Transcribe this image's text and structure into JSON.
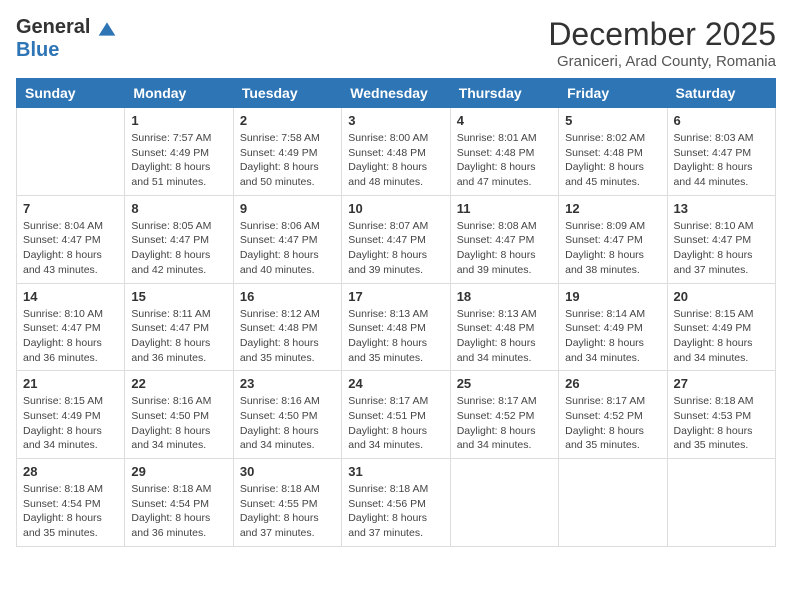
{
  "logo": {
    "general": "General",
    "blue": "Blue"
  },
  "header": {
    "month": "December 2025",
    "location": "Graniceri, Arad County, Romania"
  },
  "weekdays": [
    "Sunday",
    "Monday",
    "Tuesday",
    "Wednesday",
    "Thursday",
    "Friday",
    "Saturday"
  ],
  "weeks": [
    [
      {
        "day": "",
        "sunrise": "",
        "sunset": "",
        "daylight": ""
      },
      {
        "day": "1",
        "sunrise": "Sunrise: 7:57 AM",
        "sunset": "Sunset: 4:49 PM",
        "daylight": "Daylight: 8 hours and 51 minutes."
      },
      {
        "day": "2",
        "sunrise": "Sunrise: 7:58 AM",
        "sunset": "Sunset: 4:49 PM",
        "daylight": "Daylight: 8 hours and 50 minutes."
      },
      {
        "day": "3",
        "sunrise": "Sunrise: 8:00 AM",
        "sunset": "Sunset: 4:48 PM",
        "daylight": "Daylight: 8 hours and 48 minutes."
      },
      {
        "day": "4",
        "sunrise": "Sunrise: 8:01 AM",
        "sunset": "Sunset: 4:48 PM",
        "daylight": "Daylight: 8 hours and 47 minutes."
      },
      {
        "day": "5",
        "sunrise": "Sunrise: 8:02 AM",
        "sunset": "Sunset: 4:48 PM",
        "daylight": "Daylight: 8 hours and 45 minutes."
      },
      {
        "day": "6",
        "sunrise": "Sunrise: 8:03 AM",
        "sunset": "Sunset: 4:47 PM",
        "daylight": "Daylight: 8 hours and 44 minutes."
      }
    ],
    [
      {
        "day": "7",
        "sunrise": "Sunrise: 8:04 AM",
        "sunset": "Sunset: 4:47 PM",
        "daylight": "Daylight: 8 hours and 43 minutes."
      },
      {
        "day": "8",
        "sunrise": "Sunrise: 8:05 AM",
        "sunset": "Sunset: 4:47 PM",
        "daylight": "Daylight: 8 hours and 42 minutes."
      },
      {
        "day": "9",
        "sunrise": "Sunrise: 8:06 AM",
        "sunset": "Sunset: 4:47 PM",
        "daylight": "Daylight: 8 hours and 40 minutes."
      },
      {
        "day": "10",
        "sunrise": "Sunrise: 8:07 AM",
        "sunset": "Sunset: 4:47 PM",
        "daylight": "Daylight: 8 hours and 39 minutes."
      },
      {
        "day": "11",
        "sunrise": "Sunrise: 8:08 AM",
        "sunset": "Sunset: 4:47 PM",
        "daylight": "Daylight: 8 hours and 39 minutes."
      },
      {
        "day": "12",
        "sunrise": "Sunrise: 8:09 AM",
        "sunset": "Sunset: 4:47 PM",
        "daylight": "Daylight: 8 hours and 38 minutes."
      },
      {
        "day": "13",
        "sunrise": "Sunrise: 8:10 AM",
        "sunset": "Sunset: 4:47 PM",
        "daylight": "Daylight: 8 hours and 37 minutes."
      }
    ],
    [
      {
        "day": "14",
        "sunrise": "Sunrise: 8:10 AM",
        "sunset": "Sunset: 4:47 PM",
        "daylight": "Daylight: 8 hours and 36 minutes."
      },
      {
        "day": "15",
        "sunrise": "Sunrise: 8:11 AM",
        "sunset": "Sunset: 4:47 PM",
        "daylight": "Daylight: 8 hours and 36 minutes."
      },
      {
        "day": "16",
        "sunrise": "Sunrise: 8:12 AM",
        "sunset": "Sunset: 4:48 PM",
        "daylight": "Daylight: 8 hours and 35 minutes."
      },
      {
        "day": "17",
        "sunrise": "Sunrise: 8:13 AM",
        "sunset": "Sunset: 4:48 PM",
        "daylight": "Daylight: 8 hours and 35 minutes."
      },
      {
        "day": "18",
        "sunrise": "Sunrise: 8:13 AM",
        "sunset": "Sunset: 4:48 PM",
        "daylight": "Daylight: 8 hours and 34 minutes."
      },
      {
        "day": "19",
        "sunrise": "Sunrise: 8:14 AM",
        "sunset": "Sunset: 4:49 PM",
        "daylight": "Daylight: 8 hours and 34 minutes."
      },
      {
        "day": "20",
        "sunrise": "Sunrise: 8:15 AM",
        "sunset": "Sunset: 4:49 PM",
        "daylight": "Daylight: 8 hours and 34 minutes."
      }
    ],
    [
      {
        "day": "21",
        "sunrise": "Sunrise: 8:15 AM",
        "sunset": "Sunset: 4:49 PM",
        "daylight": "Daylight: 8 hours and 34 minutes."
      },
      {
        "day": "22",
        "sunrise": "Sunrise: 8:16 AM",
        "sunset": "Sunset: 4:50 PM",
        "daylight": "Daylight: 8 hours and 34 minutes."
      },
      {
        "day": "23",
        "sunrise": "Sunrise: 8:16 AM",
        "sunset": "Sunset: 4:50 PM",
        "daylight": "Daylight: 8 hours and 34 minutes."
      },
      {
        "day": "24",
        "sunrise": "Sunrise: 8:17 AM",
        "sunset": "Sunset: 4:51 PM",
        "daylight": "Daylight: 8 hours and 34 minutes."
      },
      {
        "day": "25",
        "sunrise": "Sunrise: 8:17 AM",
        "sunset": "Sunset: 4:52 PM",
        "daylight": "Daylight: 8 hours and 34 minutes."
      },
      {
        "day": "26",
        "sunrise": "Sunrise: 8:17 AM",
        "sunset": "Sunset: 4:52 PM",
        "daylight": "Daylight: 8 hours and 35 minutes."
      },
      {
        "day": "27",
        "sunrise": "Sunrise: 8:18 AM",
        "sunset": "Sunset: 4:53 PM",
        "daylight": "Daylight: 8 hours and 35 minutes."
      }
    ],
    [
      {
        "day": "28",
        "sunrise": "Sunrise: 8:18 AM",
        "sunset": "Sunset: 4:54 PM",
        "daylight": "Daylight: 8 hours and 35 minutes."
      },
      {
        "day": "29",
        "sunrise": "Sunrise: 8:18 AM",
        "sunset": "Sunset: 4:54 PM",
        "daylight": "Daylight: 8 hours and 36 minutes."
      },
      {
        "day": "30",
        "sunrise": "Sunrise: 8:18 AM",
        "sunset": "Sunset: 4:55 PM",
        "daylight": "Daylight: 8 hours and 37 minutes."
      },
      {
        "day": "31",
        "sunrise": "Sunrise: 8:18 AM",
        "sunset": "Sunset: 4:56 PM",
        "daylight": "Daylight: 8 hours and 37 minutes."
      },
      {
        "day": "",
        "sunrise": "",
        "sunset": "",
        "daylight": ""
      },
      {
        "day": "",
        "sunrise": "",
        "sunset": "",
        "daylight": ""
      },
      {
        "day": "",
        "sunrise": "",
        "sunset": "",
        "daylight": ""
      }
    ]
  ]
}
